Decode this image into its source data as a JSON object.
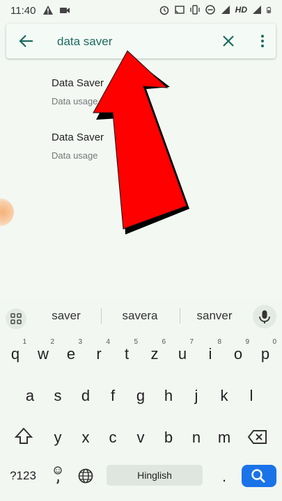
{
  "status": {
    "time": "11:40",
    "network": "HD"
  },
  "search": {
    "query": "data saver"
  },
  "results": [
    {
      "title": "Data Saver",
      "subtitle": "Data usage"
    },
    {
      "title": "Data Saver",
      "subtitle": "Data usage"
    }
  ],
  "suggestions": [
    "saver",
    "savera",
    "sanver"
  ],
  "keyboard": {
    "row1": [
      {
        "k": "q",
        "n": "1"
      },
      {
        "k": "w",
        "n": "2"
      },
      {
        "k": "e",
        "n": "3"
      },
      {
        "k": "r",
        "n": "4"
      },
      {
        "k": "t",
        "n": "5"
      },
      {
        "k": "z",
        "n": "6"
      },
      {
        "k": "u",
        "n": "7"
      },
      {
        "k": "i",
        "n": "8"
      },
      {
        "k": "o",
        "n": "9"
      },
      {
        "k": "p",
        "n": "0"
      }
    ],
    "row2": [
      "a",
      "s",
      "d",
      "f",
      "g",
      "h",
      "j",
      "k",
      "l"
    ],
    "row3": [
      "y",
      "x",
      "c",
      "v",
      "b",
      "n",
      "m"
    ],
    "sym_label": "?123",
    "space_label": "Hinglish",
    "period": "."
  },
  "colors": {
    "accent": "#1d6b5e",
    "search_key": "#1a73e8",
    "arrow": "#ff0000"
  }
}
